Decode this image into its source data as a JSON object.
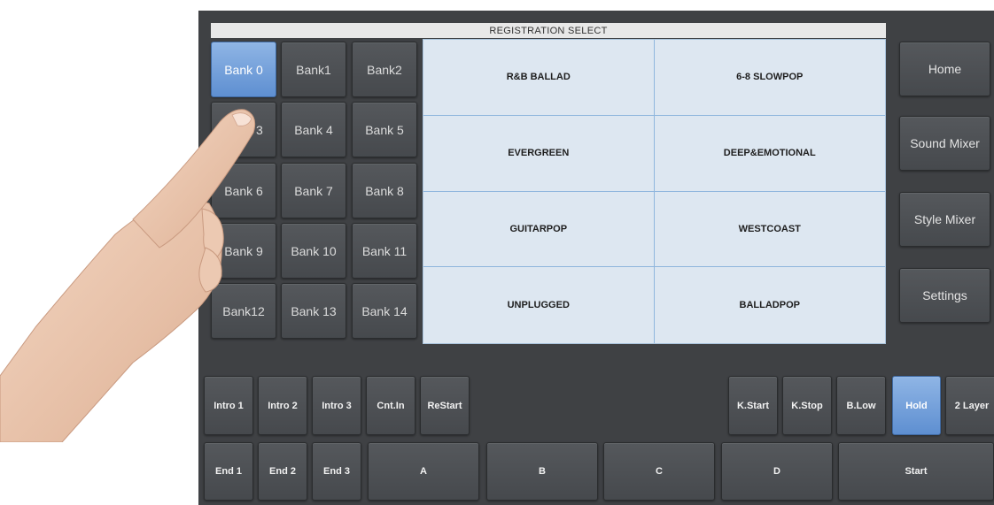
{
  "title": "REGISTRATION SELECT",
  "banks": [
    {
      "label": "Bank 0",
      "active": true
    },
    {
      "label": "Bank1"
    },
    {
      "label": "Bank2"
    },
    {
      "label": "Bank 3"
    },
    {
      "label": "Bank 4"
    },
    {
      "label": "Bank 5"
    },
    {
      "label": "Bank 6"
    },
    {
      "label": "Bank 7"
    },
    {
      "label": "Bank 8"
    },
    {
      "label": "Bank 9"
    },
    {
      "label": "Bank 10"
    },
    {
      "label": "Bank 11"
    },
    {
      "label": "Bank12"
    },
    {
      "label": "Bank 13"
    },
    {
      "label": "Bank 14"
    }
  ],
  "registrations": [
    "R&B BALLAD",
    "6-8 SLOWPOP",
    "EVERGREEN",
    "DEEP&EMOTIONAL",
    "GUITARPOP",
    "WESTCOAST",
    "UNPLUGGED",
    "BALLADPOP"
  ],
  "side_menu": {
    "home": "Home",
    "sound_mixer": "Sound Mixer",
    "style_mixer": "Style Mixer",
    "settings": "Settings"
  },
  "row1": {
    "intro1": "Intro 1",
    "intro2": "Intro 2",
    "intro3": "Intro 3",
    "cnt_in": "Cnt.In",
    "restart": "ReStart",
    "k_start": "K.Start",
    "k_stop": "K.Stop",
    "b_low": "B.Low",
    "hold": "Hold",
    "two_layer": "2 Layer"
  },
  "row2": {
    "end1": "End 1",
    "end2": "End 2",
    "end3": "End 3",
    "a": "A",
    "b": "B",
    "c": "C",
    "d": "D",
    "start": "Start"
  },
  "colors": {
    "panel": "#3f4144",
    "active_blue": "#6e9bd8",
    "grid_bg": "#dde7f1"
  }
}
